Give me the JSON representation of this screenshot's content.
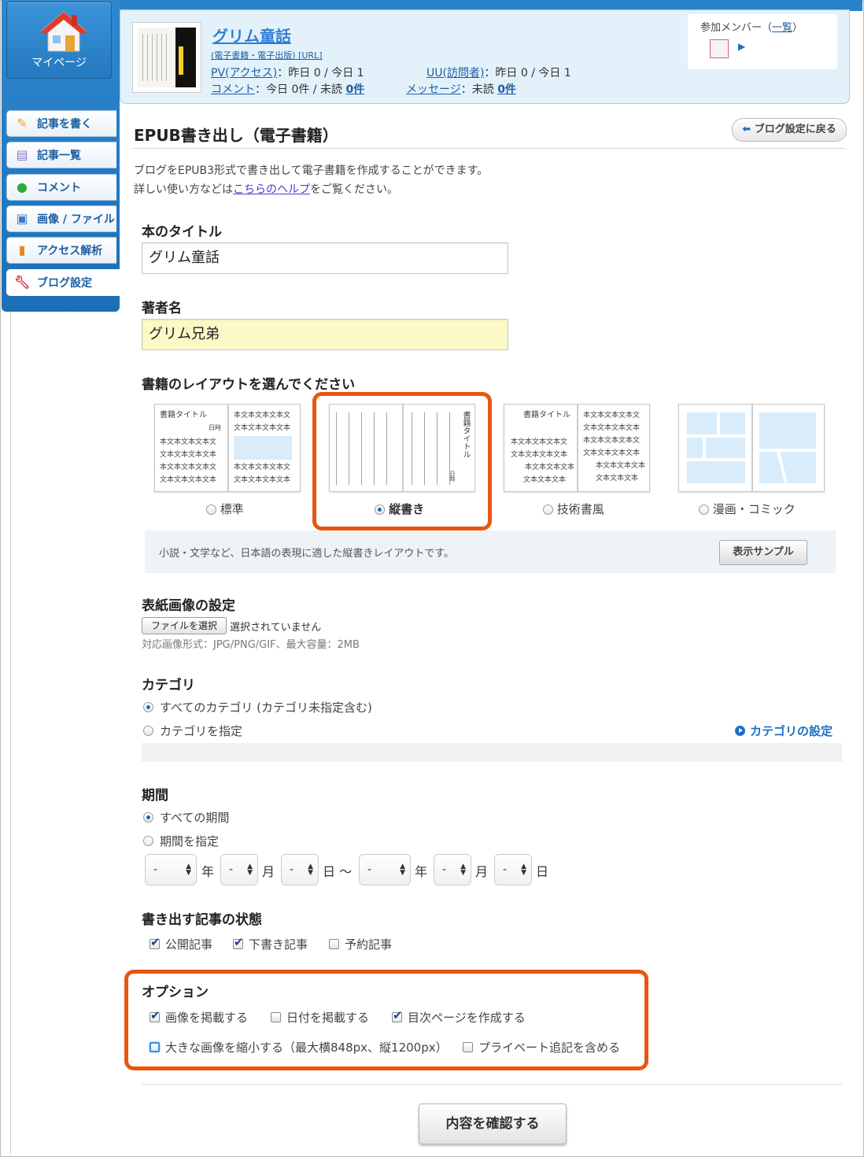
{
  "sidebar": {
    "mypage_label": "マイページ",
    "items": [
      {
        "label": "記事を書く",
        "icon": "pencil-icon"
      },
      {
        "label": "記事一覧",
        "icon": "document-icon"
      },
      {
        "label": "コメント",
        "icon": "speech-bubble-icon"
      },
      {
        "label": "画像 / ファイル",
        "icon": "image-icon"
      },
      {
        "label": "アクセス解析",
        "icon": "bar-chart-icon"
      },
      {
        "label": "ブログ設定",
        "icon": "wrench-icon"
      }
    ]
  },
  "header": {
    "blog_title": "グリム童話",
    "blog_sub": "(電子書籍・電子出版) [URL]",
    "pv_label": "PV(アクセス)",
    "pv_value": "：昨日 0 / 今日 1",
    "uu_label": "UU(訪問者)",
    "uu_value": "：昨日 0 / 今日 1",
    "comment_label": "コメント",
    "comment_value": "：今日 0件 / 未読",
    "comment_unread": "0件",
    "message_label": "メッセージ",
    "message_value": "：未読",
    "message_unread": "0件",
    "members_label": "参加メンバー（",
    "members_link": "一覧",
    "members_close": "）"
  },
  "page": {
    "title": "EPUB書き出し（電子書籍）",
    "back_button": "ブログ設定に戻る",
    "desc1": "ブログをEPUB3形式で書き出して電子書籍を作成することができます。",
    "desc2_pre": "詳しい使い方などは",
    "desc2_link": "こちらのヘルプ",
    "desc2_post": "をご覧ください。"
  },
  "book_title": {
    "label": "本のタイトル",
    "value": "グリム童話"
  },
  "author": {
    "label": "著者名",
    "value": "グリム兄弟"
  },
  "layout": {
    "label": "書籍のレイアウトを選んでください",
    "options": [
      {
        "label": "標準",
        "selected": false
      },
      {
        "label": "縦書き",
        "selected": true
      },
      {
        "label": "技術書風",
        "selected": false
      },
      {
        "label": "漫画・コミック",
        "selected": false
      }
    ],
    "mini_title": "書籍タイトル",
    "mini_date": "日時",
    "mini_text1": "本文本文本文本文",
    "mini_text2": "文本文本文本文本",
    "mini_text3": "本文本文本文本",
    "mini_text4": "文本文本文本",
    "note": "小説・文学など、日本語の表現に適した縦書きレイアウトです。",
    "sample_button": "表示サンプル"
  },
  "cover": {
    "label": "表紙画像の設定",
    "file_button": "ファイルを選択",
    "file_status": "選択されていません",
    "note": "対応画像形式：JPG/PNG/GIF、最大容量：2MB"
  },
  "category": {
    "label": "カテゴリ",
    "opt_all": "すべてのカテゴリ (カテゴリ未指定含む)",
    "opt_specify": "カテゴリを指定",
    "settings_link": "カテゴリの設定"
  },
  "period": {
    "label": "期間",
    "opt_all": "すべての期間",
    "opt_specify": "期間を指定",
    "select_value": "-",
    "unit_year": "年",
    "unit_month": "月",
    "unit_day_from": "日 〜",
    "unit_day": "日"
  },
  "status": {
    "label": "書き出す記事の状態",
    "published": "公開記事",
    "draft": "下書き記事",
    "scheduled": "予約記事"
  },
  "options": {
    "label": "オプション",
    "include_images": "画像を掲載する",
    "include_date": "日付を掲載する",
    "create_toc": "目次ページを作成する",
    "shrink_images": "大きな画像を縮小する（最大横848px、縦1200px）",
    "include_private": "プライベート追記を含める"
  },
  "confirm_button": "内容を確認する",
  "colors": {
    "accent": "#2a82c9",
    "highlight": "#e8570e",
    "link": "#1d5fa2"
  }
}
